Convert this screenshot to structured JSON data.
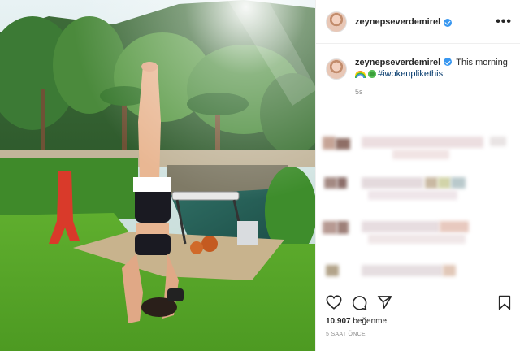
{
  "post": {
    "username": "zeynepseverdemirel",
    "caption_text": "This morning",
    "hashtag": "#iwokeuplikethis",
    "caption_time": "5s",
    "likes_count": "10.907",
    "likes_label": "beğenme",
    "posted_ago": "5 SAAT ÖNCE"
  },
  "icons": {
    "more": "more-icon",
    "like": "heart-icon",
    "comment": "comment-icon",
    "share": "paper-plane-icon",
    "save": "bookmark-icon",
    "verified": "verified-badge-icon"
  },
  "colors": {
    "verified": "#3897f0",
    "hashtag": "#00376b",
    "muted": "#8e8e8e",
    "text": "#262626"
  }
}
